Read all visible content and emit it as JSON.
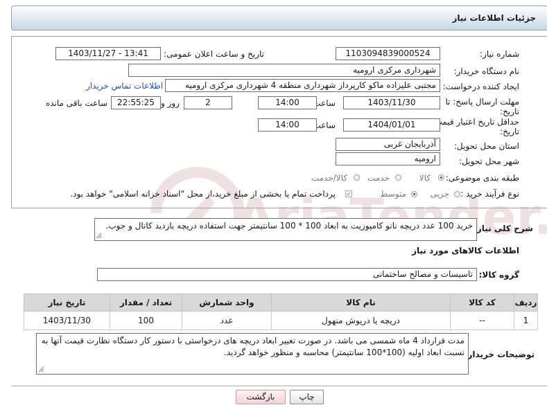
{
  "header": {
    "title": "جزئیات اطلاعات نیاز"
  },
  "form": {
    "need_number": {
      "label": "شماره نیاز:",
      "value": "1103094839000524"
    },
    "announce": {
      "label": "تاریخ و ساعت اعلان عمومی:",
      "value": "1403/11/27 - 13:41"
    },
    "buyer_org": {
      "label": "نام دستگاه خریدار:",
      "value": "شهرداری مرکزی ارومیه"
    },
    "creator": {
      "label": "ایجاد کننده درخواست:",
      "value": "مجتبی علیزاده ماکو کارپرداز شهرداری منطقه 4 شهرداری مرکزی ارومیه",
      "contact_link": "اطلاعات تماس خریدار"
    },
    "deadline": {
      "label_line1": "مهلت ارسال پاسخ: تا",
      "label_line2": "تاریخ:",
      "date": "1403/11/30",
      "time_label": "ساعت",
      "time": "14:00",
      "days": "2",
      "days_label": "روز و",
      "remaining": "22:55:25",
      "remaining_label": "ساعت باقی مانده"
    },
    "price_validity": {
      "label_line1": "حداقل تاریخ اعتبار قیمت: تا",
      "label_line2": "تاریخ:",
      "date": "1404/01/01",
      "time_label": "ساعت",
      "time": "14:00"
    },
    "province": {
      "label": "استان محل تحویل:",
      "value": "آذربایجان غربی"
    },
    "city": {
      "label": "شهر محل تحویل:",
      "value": "ارومیه"
    },
    "category": {
      "label": "طبقه بندی موضوعی:",
      "options": [
        "کالا",
        "خدمت",
        "کالا/خدمت"
      ],
      "selected": "کالا"
    },
    "process": {
      "label": "نوع فرآیند خرید :",
      "options": [
        "جزیی",
        "متوسط"
      ],
      "selected": "متوسط",
      "payment_note": "پرداخت تمام یا بخشی از مبلغ خرید،از محل \"اسناد خزانه اسلامی\" خواهد بود."
    }
  },
  "description": {
    "label": "شرح کلی نیاز:",
    "value": "خرید 100 عدد دریچه نانو کامپوزیت به ابعاد 100 * 100 سانتیمتر جهت استفاده دریچه بازدید کانال و جوب."
  },
  "goods": {
    "section_title": "اطلاعات کالاهای مورد نیاز",
    "group_label": "گروه کالا:",
    "group_value": "تاسیسات و مصالح ساختمانی",
    "table": {
      "headers": [
        "ردیف",
        "کد کالا",
        "نام کالا",
        "واحد شمارش",
        "تعداد / مقدار",
        "تاریخ نیاز"
      ],
      "rows": [
        [
          "1",
          "--",
          "دریچه یا دریوش منهول",
          "عدد",
          "100",
          "1403/11/30"
        ]
      ]
    }
  },
  "buyer_notes": {
    "label": "توضیحات خریدار:",
    "value": "مدت قرارداد 4 ماه شمسی می باشد. در صورت تغییر ابعاد دریچه های درخواستی با دستور کار دستگاه نظارت قیمت آنها به نسبت ابعاد اولیه (100*100 سانتیمتر) محاسبه و منظور خواهد گردید."
  },
  "buttons": {
    "print": "چاپ",
    "back": "بازگشت"
  },
  "watermark": {
    "text": "AriaTender.net"
  }
}
